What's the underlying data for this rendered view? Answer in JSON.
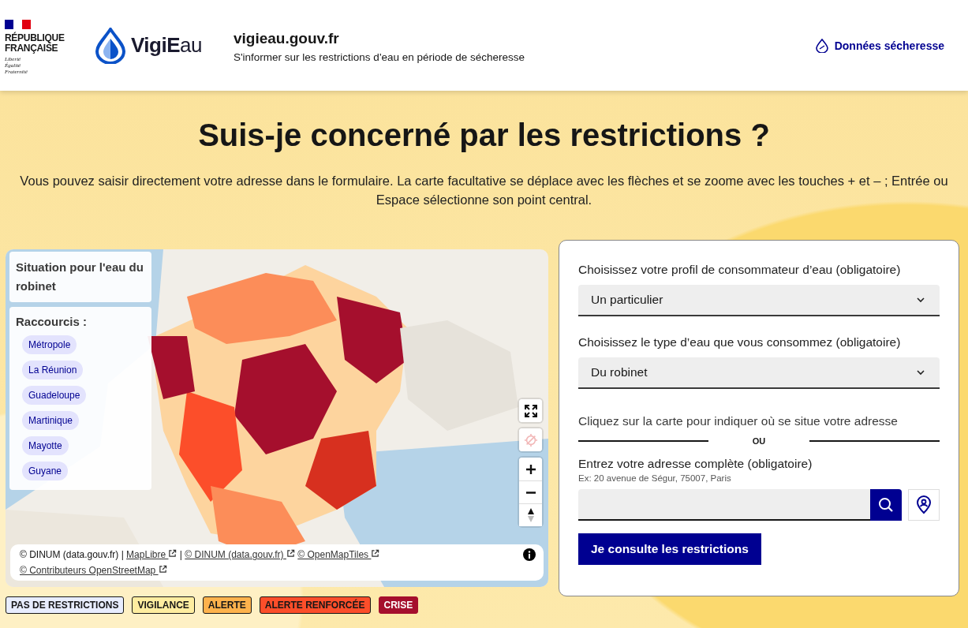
{
  "header": {
    "brand": {
      "lines": [
        "RÉPUBLIQUE",
        "FRANÇAISE"
      ],
      "motto": [
        "Liberté",
        "Égalité",
        "Fraternité"
      ]
    },
    "logo": "**VigiE**au",
    "site_name": "vigieau.gouv.fr",
    "tagline": "S'informer sur les restrictions d'eau en période de sécheresse",
    "link": "Données sécheresse"
  },
  "title": "Suis-je concerné par les restrictions ?",
  "intro": "Vous pouvez saisir directement votre adresse dans le formulaire. La carte facultative se déplace avec les flèches et se zoome avec les touches + et – ; Entrée ou Espace sélectionne son point central.",
  "map": {
    "situation": "Situation pour l'eau du robinet",
    "shortcuts_title": "Raccourcis :",
    "shortcuts": [
      "Métropole",
      "La Réunion",
      "Guadeloupe",
      "Martinique",
      "Mayotte",
      "Guyane"
    ],
    "controls": [
      {
        "kind": "fullscreen",
        "disabled": false
      },
      {
        "kind": "geolocate",
        "disabled": true
      },
      {
        "kind": "zoom_in",
        "disabled": false
      },
      {
        "kind": "zoom_out",
        "disabled": false
      },
      {
        "kind": "compass",
        "disabled": false
      }
    ],
    "attribution": [
      {
        "kind": "text",
        "text": "© DINUM (data.gouv.fr) |"
      },
      {
        "kind": "link",
        "text": "MapLibre"
      },
      {
        "kind": "text",
        "text": "|"
      },
      {
        "kind": "link",
        "text": "© DINUM (data.gouv.fr)"
      },
      {
        "kind": "link",
        "text": "© OpenMapTiles"
      },
      {
        "kind": "link",
        "text": "© Contributeurs OpenStreetMap"
      }
    ]
  },
  "legend": [
    {
      "label": "PAS DE RESTRICTIONS",
      "color": "#e8edff"
    },
    {
      "label": "VIGILANCE",
      "color": "#ffeda0"
    },
    {
      "label": "ALERTE",
      "color": "#feb24c"
    },
    {
      "label": "ALERTE RENFORCÉE",
      "color": "#fc4e2a"
    },
    {
      "label": "CRISE",
      "color": "#a50f2d"
    }
  ],
  "form": {
    "profile_label": "Choisissez votre profil de consommateur d’eau (obligatoire)",
    "profile_value": "Un particulier",
    "water_label": "Choisissez le type d’eau que vous consommez (obligatoire)",
    "water_value": "Du robinet",
    "map_hint": "Cliquez sur la carte pour indiquer où se situe votre adresse",
    "separator": "OU",
    "address_label": "Entrez votre adresse complète (obligatoire)",
    "address_hint": "Ex: 20 avenue de Ségur, 75007, Paris",
    "submit": "Je consulte les restrictions"
  }
}
